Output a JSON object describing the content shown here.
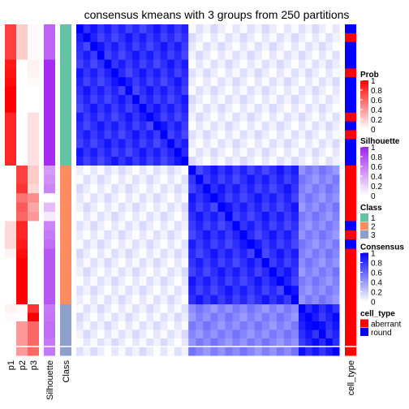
{
  "chart_data": {
    "type": "heatmap",
    "title": "consensus kmeans with 3 groups from 250 partitions",
    "row_groups": [
      {
        "class": 1,
        "n_rows": 30
      },
      {
        "class": 2,
        "n_rows": 30
      },
      {
        "class": 3,
        "n_rows": 11
      }
    ],
    "annotation_columns": [
      "p1",
      "p2",
      "p3",
      "Silhouette",
      "Class"
    ],
    "right_annotation_column": "cell_type",
    "rows": {
      "p1": [
        0.75,
        0.75,
        0.75,
        0.75,
        0.9,
        0.92,
        0.95,
        1,
        1,
        1,
        0.85,
        0.85,
        0.85,
        0.85,
        0.85,
        0.85,
        0,
        0,
        0,
        0,
        0,
        0,
        0.15,
        0.15,
        0.15,
        0.05,
        0,
        0,
        0,
        0,
        0,
        0.05,
        0.02,
        0,
        0,
        0,
        0
      ],
      "p2": [
        0.2,
        0.2,
        0.2,
        0.2,
        0,
        0,
        0,
        0,
        0,
        0,
        0,
        0,
        0,
        0,
        0,
        0,
        0.75,
        0.75,
        0.8,
        0.55,
        0.65,
        0.6,
        0.85,
        0.85,
        0.9,
        0.95,
        1,
        1,
        1,
        1,
        1,
        0.02,
        0,
        0.4,
        0.4,
        0.4,
        0.4
      ],
      "p3": [
        0.02,
        0.02,
        0.02,
        0.02,
        0.05,
        0.05,
        0.02,
        0,
        0,
        0,
        0.12,
        0.12,
        0.12,
        0.12,
        0.12,
        0.12,
        0.2,
        0.2,
        0.15,
        0.45,
        0.35,
        0.4,
        0,
        0,
        0,
        0,
        0,
        0,
        0,
        0,
        0,
        0.8,
        1,
        0.6,
        0.6,
        0.6,
        0.6
      ],
      "Silhouette": [
        0.7,
        0.7,
        0.7,
        0.7,
        0.95,
        0.95,
        0.95,
        0.95,
        0.95,
        0.95,
        0.95,
        0.95,
        0.95,
        0.95,
        0.95,
        0.95,
        0.45,
        0.5,
        0.55,
        0,
        0.3,
        0.1,
        0.55,
        0.6,
        0.65,
        0.75,
        0.75,
        0.75,
        0.75,
        0.75,
        0.75,
        0.6,
        0.62,
        0.65,
        0.65,
        0.6,
        0.6
      ],
      "cell_type": [
        "round",
        "aberrant",
        "round",
        "round",
        "round",
        "aberrant",
        "round",
        "round",
        "round",
        "round",
        "aberrant",
        "round",
        "aberrant",
        "round",
        "round",
        "round",
        "aberrant",
        "aberrant",
        "aberrant",
        "aberrant",
        "aberrant",
        "aberrant",
        "round",
        "aberrant",
        "round",
        "aberrant",
        "aberrant",
        "aberrant",
        "aberrant",
        "aberrant",
        "aberrant",
        "aberrant",
        "aberrant",
        "aberrant",
        "aberrant",
        "aberrant",
        "aberrant"
      ]
    },
    "consensus_blocks": {
      "within_1": 0.8,
      "within_2": 0.8,
      "within_3": 0.85,
      "between_1_2": 0.05,
      "between_1_3": 0.05,
      "between_2_3": 0.45
    },
    "legends": [
      {
        "title": "Prob",
        "ticks": [
          "1",
          "0.8",
          "0.6",
          "0.4",
          "0.2",
          "0"
        ],
        "low": "#FFFFFF",
        "high": "#FF0000"
      },
      {
        "title": "Silhouette",
        "ticks": [
          "1",
          "0.8",
          "0.6",
          "0.4",
          "0.2",
          "0"
        ],
        "low": "#FFFFFF",
        "high": "#A020F0"
      },
      {
        "title": "Class",
        "items": [
          {
            "label": "1",
            "color": "#66C2A5"
          },
          {
            "label": "2",
            "color": "#FC8D62"
          },
          {
            "label": "3",
            "color": "#8DA0CB"
          }
        ]
      },
      {
        "title": "Consensus",
        "ticks": [
          "1",
          "0.8",
          "0.6",
          "0.4",
          "0.2",
          "0"
        ],
        "low": "#FFFFFF",
        "high": "#0000FF"
      },
      {
        "title": "cell_type",
        "items": [
          {
            "label": "aberrant",
            "color": "#FF0000"
          },
          {
            "label": "round",
            "color": "#0000FF"
          }
        ]
      }
    ],
    "class_colors": {
      "1": "#66C2A5",
      "2": "#FC8D62",
      "3": "#8DA0CB"
    },
    "cell_type_colors": {
      "aberrant": "#FF0000",
      "round": "#0000FF"
    }
  }
}
